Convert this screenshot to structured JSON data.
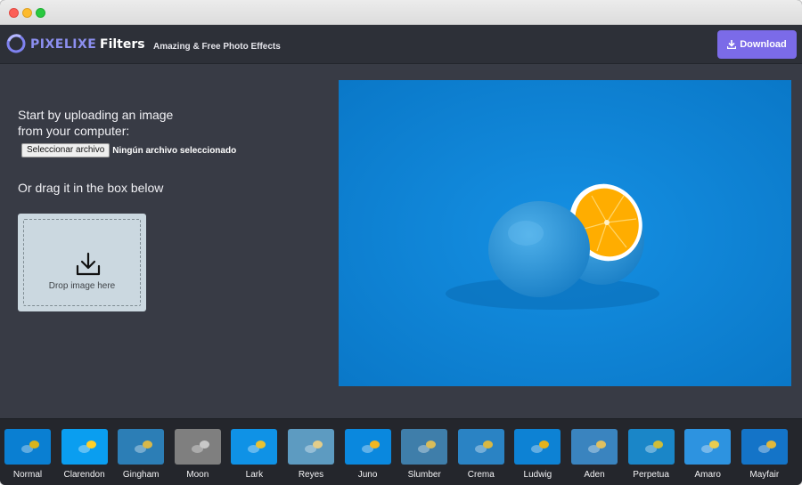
{
  "header": {
    "brand": "PIXELIXE",
    "brand_suffix": "Filters",
    "tagline": "Amazing & Free Photo Effects",
    "download_label": "Download"
  },
  "upload": {
    "intro": "Start by uploading an image from your computer:",
    "file_button": "Seleccionar archivo",
    "file_status": "Ningún archivo seleccionado",
    "drag_text": "Or drag it in the box below",
    "drop_label": "Drop image here"
  },
  "filters": [
    {
      "label": "Normal",
      "bg": "#0a7fd2",
      "fruit": "#d8b41c"
    },
    {
      "label": "Clarendon",
      "bg": "#0a9ef0",
      "fruit": "#ffd028"
    },
    {
      "label": "Gingham",
      "bg": "#2c7eb6",
      "fruit": "#d7b84a"
    },
    {
      "label": "Moon",
      "bg": "#7f7f7f",
      "fruit": "#c8c8c8"
    },
    {
      "label": "Lark",
      "bg": "#0f92e6",
      "fruit": "#e8c232"
    },
    {
      "label": "Reyes",
      "bg": "#5d9bc1",
      "fruit": "#e2cd8a"
    },
    {
      "label": "Juno",
      "bg": "#0a88de",
      "fruit": "#f0b620"
    },
    {
      "label": "Slumber",
      "bg": "#3f7eaa",
      "fruit": "#d8bc5a"
    },
    {
      "label": "Crema",
      "bg": "#2a83c4",
      "fruit": "#d8b844"
    },
    {
      "label": "Ludwig",
      "bg": "#0d82d4",
      "fruit": "#e3b21c"
    },
    {
      "label": "Aden",
      "bg": "#3a84bf",
      "fruit": "#e0c060"
    },
    {
      "label": "Perpetua",
      "bg": "#1a86c8",
      "fruit": "#cfbd38"
    },
    {
      "label": "Amaro",
      "bg": "#2d93e0",
      "fruit": "#e8cc50"
    },
    {
      "label": "Mayfair",
      "bg": "#1474c8",
      "fruit": "#e0b83c"
    }
  ],
  "colors": {
    "accent": "#7b6be8",
    "preview_bg": "#0b84d9",
    "fruit_skin": "#3aa0e0",
    "fruit_flesh": "#ffb400"
  }
}
